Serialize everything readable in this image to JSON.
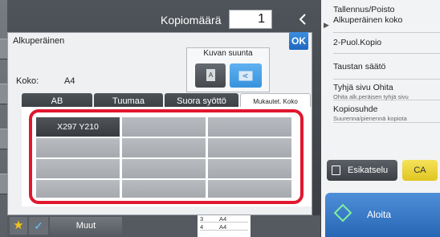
{
  "header": {
    "copies_label": "Kopiomäärä",
    "copies_value": "1"
  },
  "right_panel": {
    "items": [
      {
        "title": "Tallennus/Poisto\nAlkuperäinen koko",
        "subtitle": ""
      },
      {
        "title": "2-Puol.Kopio",
        "subtitle": ""
      },
      {
        "title": "Taustan säätö",
        "subtitle": ""
      },
      {
        "title": "Tyhjä sivu Ohita",
        "subtitle": "Ohita alk.peräisen tyhjä sivu"
      },
      {
        "title": "Kopiosuhde",
        "subtitle": "Suurenna/pienennä kopiota"
      }
    ],
    "preview_label": "Esikatselu",
    "ca_label": "CA",
    "start_label": "Aloita"
  },
  "dialog": {
    "title": "Alkuperäinen",
    "ok_label": "OK",
    "size_label": "Koko:",
    "size_value": "A4",
    "orientation_title": "Kuvan suunta",
    "orientation_portrait_glyph": "A",
    "orientation_landscape_glyph": "A",
    "tabs": [
      "AB",
      "Tuumaa",
      "Suora syöttö",
      "Mukautet. Koko"
    ],
    "active_tab": "Mukautet. Koko",
    "custom_sizes": [
      "X297 Y210",
      "",
      "",
      "",
      "",
      "",
      "",
      "",
      "",
      "",
      "",
      "",
      "",
      "",
      ""
    ]
  },
  "bottom": {
    "muut_label": "Muut",
    "tray_rows": [
      {
        "n": "3",
        "size": "A4"
      },
      {
        "n": "4",
        "size": "A4"
      }
    ]
  },
  "colors": {
    "highlight_frame": "#e0182f",
    "start_button": "#2766b4",
    "ca_button": "#e0c521",
    "ok_button": "#1e68bf"
  }
}
